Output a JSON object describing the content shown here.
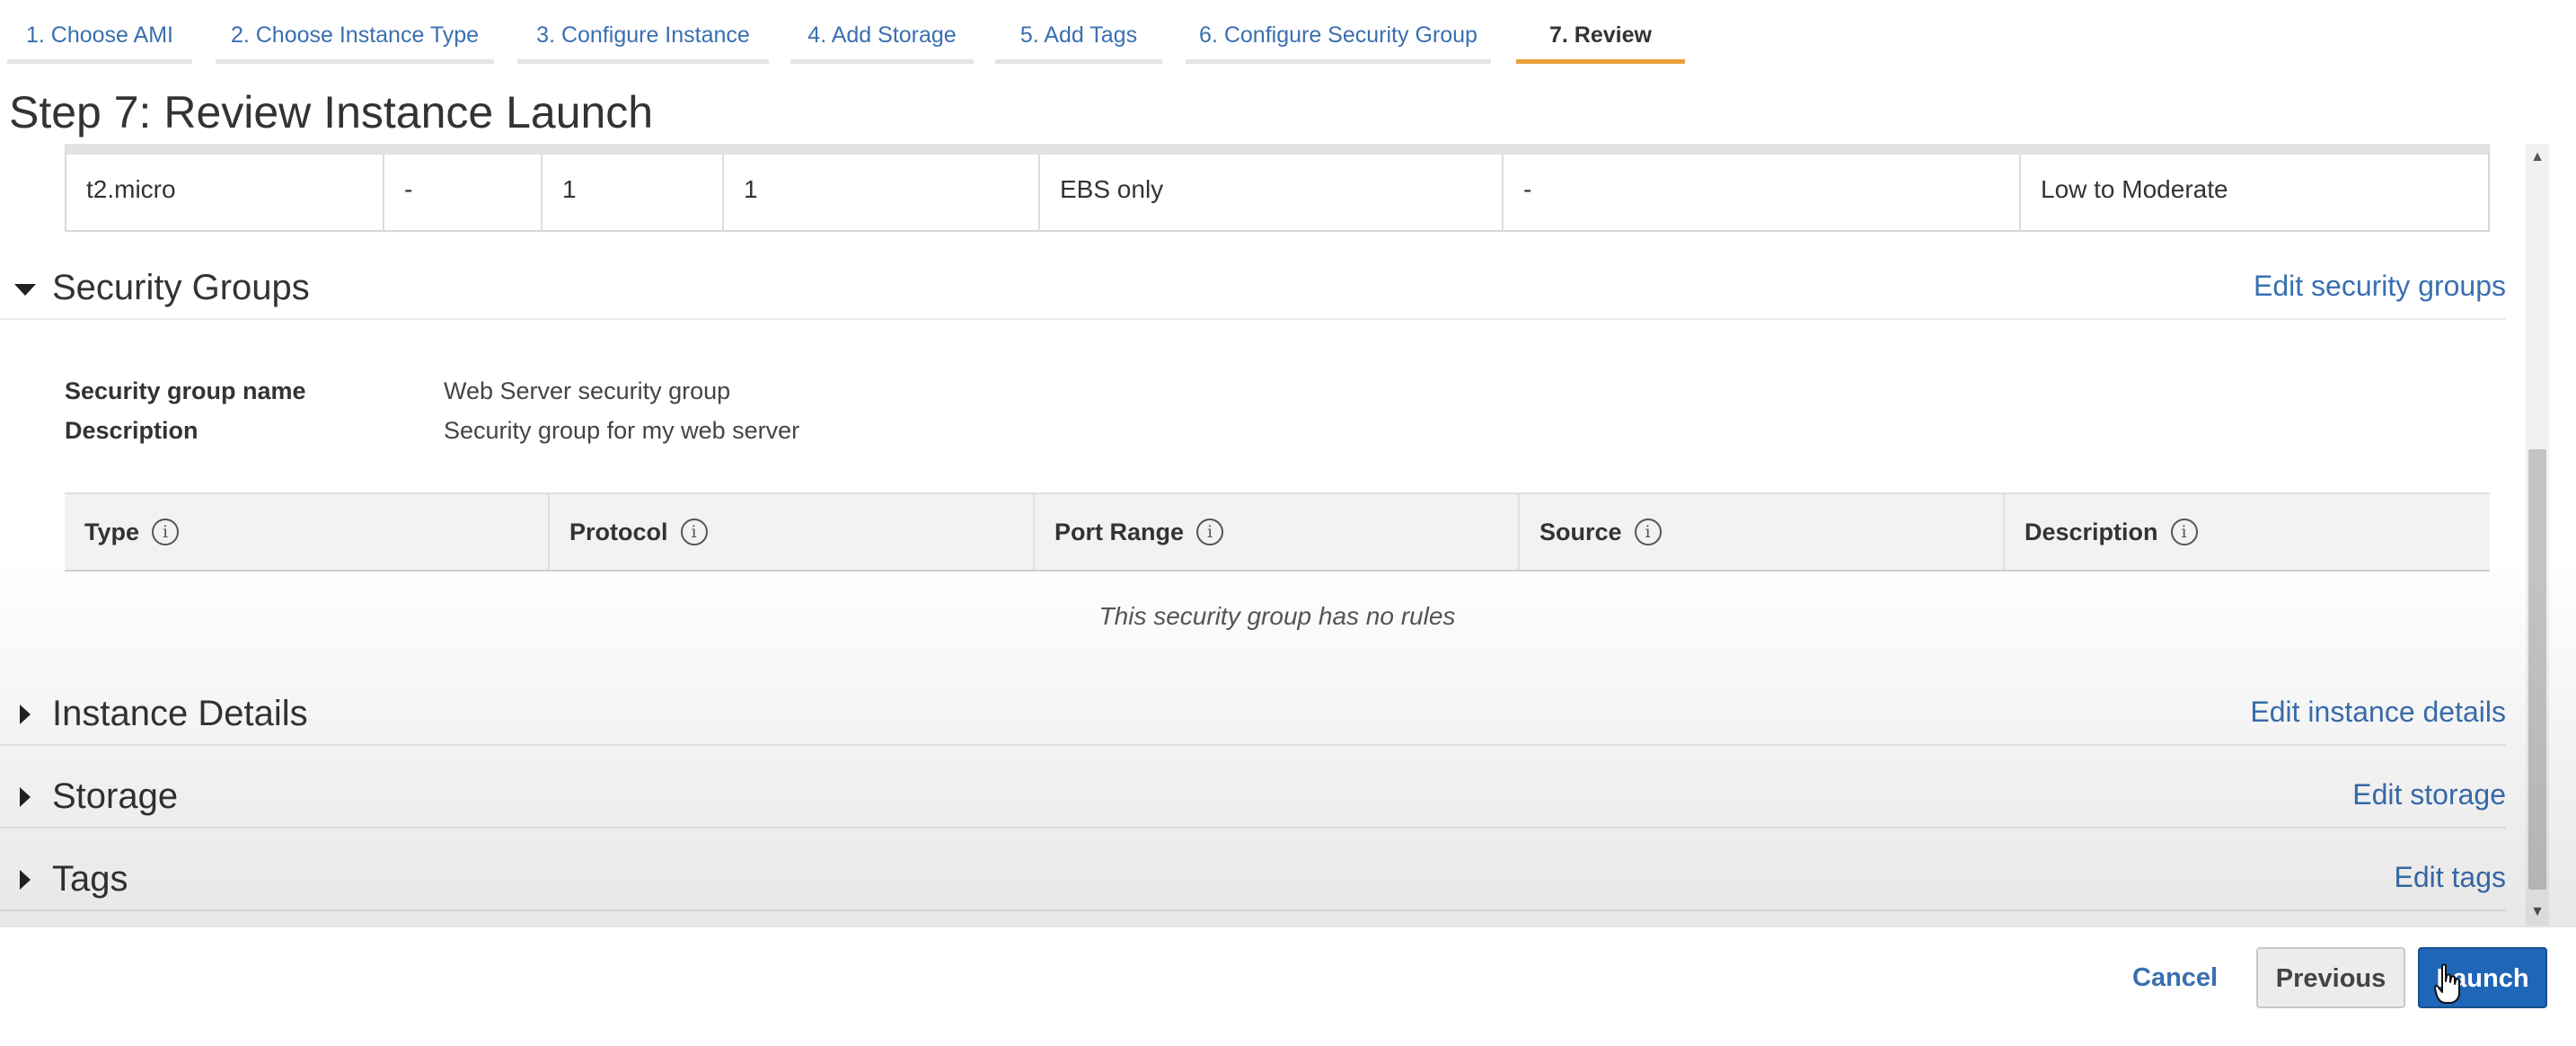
{
  "wizard": {
    "tabs": [
      {
        "label": "1. Choose AMI"
      },
      {
        "label": "2. Choose Instance Type"
      },
      {
        "label": "3. Configure Instance"
      },
      {
        "label": "4. Add Storage"
      },
      {
        "label": "5. Add Tags"
      },
      {
        "label": "6. Configure Security Group"
      },
      {
        "label": "7. Review"
      }
    ],
    "active_tab": "7. Review",
    "active_color": "#e8a23a"
  },
  "page_title": "Step 7: Review Instance Launch",
  "instance_type_row": {
    "cells": [
      "t2.micro",
      "-",
      "1",
      "1",
      "EBS only",
      "-",
      "Low to Moderate"
    ]
  },
  "security_groups": {
    "title": "Security Groups",
    "edit_link": "Edit security groups",
    "expanded": true,
    "name_label": "Security group name",
    "name_value": "Web Server security group",
    "description_label": "Description",
    "description_value": "Security group for my web server",
    "rules_columns": [
      {
        "label": "Type"
      },
      {
        "label": "Protocol"
      },
      {
        "label": "Port Range"
      },
      {
        "label": "Source"
      },
      {
        "label": "Description"
      }
    ],
    "info_glyph": "i",
    "empty_message": "This security group has no rules"
  },
  "instance_details": {
    "title": "Instance Details",
    "edit_link": "Edit instance details"
  },
  "storage": {
    "title": "Storage",
    "edit_link": "Edit storage"
  },
  "tags": {
    "title": "Tags",
    "edit_link": "Edit tags"
  },
  "footer": {
    "cancel_label": "Cancel",
    "previous_label": "Previous",
    "launch_label": "Launch"
  },
  "colors": {
    "link": "#3a6fb0",
    "launch_button": "#1f66b8",
    "tab_active_underline": "#e8a23a"
  }
}
